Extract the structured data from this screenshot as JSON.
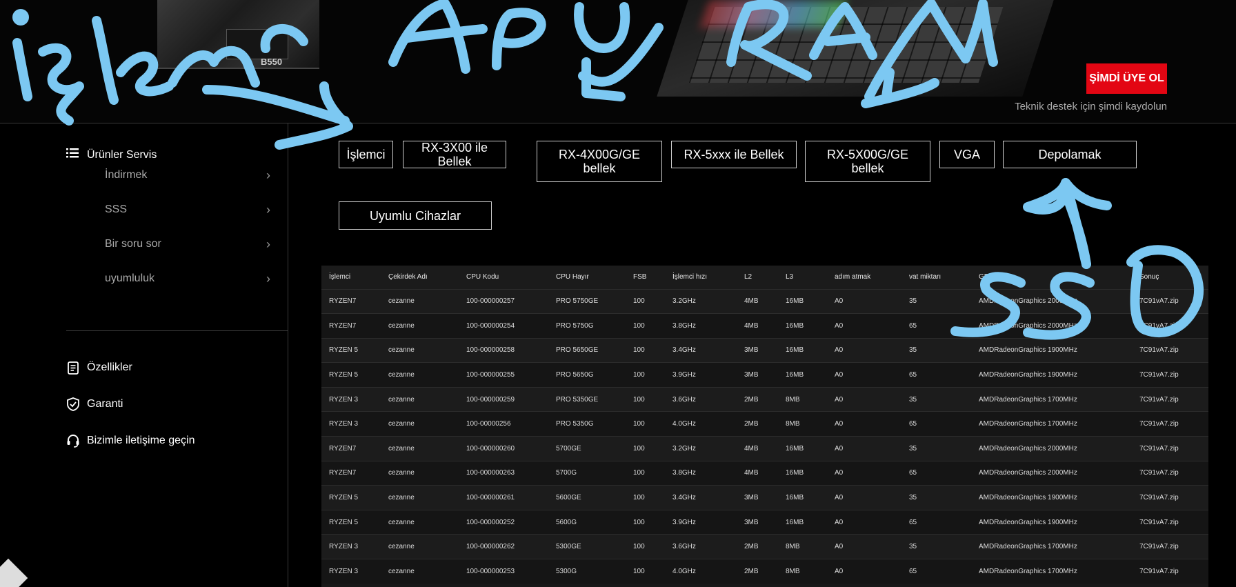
{
  "header": {
    "mobo_text": "B550",
    "signup_button": "ŞİMDİ ÜYE OL",
    "signup_note": "Teknik destek için şimdi kaydolun"
  },
  "sidebar": {
    "heading": "Ürünler Servis",
    "items": [
      {
        "label": "İndirmek"
      },
      {
        "label": "SSS"
      },
      {
        "label": "Bir soru sor"
      },
      {
        "label": "uyumluluk"
      }
    ],
    "links": [
      {
        "label": "Özellikler",
        "icon": "document-icon"
      },
      {
        "label": "Garanti",
        "icon": "shield-check-icon"
      },
      {
        "label": "Bizimle iletişime geçin",
        "icon": "headset-icon"
      }
    ]
  },
  "tabs": [
    {
      "label": "İşlemci"
    },
    {
      "label": "RX-3X00 ile Bellek"
    },
    {
      "label": "RX-4X00G/GE bellek"
    },
    {
      "label": "RX-5xxx ile Bellek"
    },
    {
      "label": "RX-5X00G/GE bellek"
    },
    {
      "label": "VGA"
    },
    {
      "label": "Depolamak"
    },
    {
      "label": "Uyumlu Cihazlar"
    }
  ],
  "table": {
    "headers": [
      "İşlemci",
      "Çekirdek Adı",
      "CPU Kodu",
      "CPU Hayır",
      "FSB",
      "İşlemci hızı",
      "L2",
      "L3",
      "adım atmak",
      "vat miktarı",
      "GPU",
      "Sonuç"
    ],
    "rows": [
      [
        "RYZEN7",
        "cezanne",
        "100-000000257",
        "PRO 5750GE",
        "100",
        "3.2GHz",
        "4MB",
        "16MB",
        "A0",
        "35",
        "AMDRadeonGraphics 2000MHz",
        "7C91vA7.zip"
      ],
      [
        "RYZEN7",
        "cezanne",
        "100-000000254",
        "PRO 5750G",
        "100",
        "3.8GHz",
        "4MB",
        "16MB",
        "A0",
        "65",
        "AMDRadeonGraphics 2000MHz",
        "7C91vA7.zip"
      ],
      [
        "RYZEN 5",
        "cezanne",
        "100-000000258",
        "PRO 5650GE",
        "100",
        "3.4GHz",
        "3MB",
        "16MB",
        "A0",
        "35",
        "AMDRadeonGraphics 1900MHz",
        "7C91vA7.zip"
      ],
      [
        "RYZEN 5",
        "cezanne",
        "100-000000255",
        "PRO 5650G",
        "100",
        "3.9GHz",
        "3MB",
        "16MB",
        "A0",
        "65",
        "AMDRadeonGraphics 1900MHz",
        "7C91vA7.zip"
      ],
      [
        "RYZEN 3",
        "cezanne",
        "100-000000259",
        "PRO 5350GE",
        "100",
        "3.6GHz",
        "2MB",
        "8MB",
        "A0",
        "35",
        "AMDRadeonGraphics 1700MHz",
        "7C91vA7.zip"
      ],
      [
        "RYZEN 3",
        "cezanne",
        "100-00000256",
        "PRO 5350G",
        "100",
        "4.0GHz",
        "2MB",
        "8MB",
        "A0",
        "65",
        "AMDRadeonGraphics 1700MHz",
        "7C91vA7.zip"
      ],
      [
        "RYZEN7",
        "cezanne",
        "100-000000260",
        "5700GE",
        "100",
        "3.2GHz",
        "4MB",
        "16MB",
        "A0",
        "35",
        "AMDRadeonGraphics 2000MHz",
        "7C91vA7.zip"
      ],
      [
        "RYZEN7",
        "cezanne",
        "100-000000263",
        "5700G",
        "100",
        "3.8GHz",
        "4MB",
        "16MB",
        "A0",
        "65",
        "AMDRadeonGraphics 2000MHz",
        "7C91vA7.zip"
      ],
      [
        "RYZEN 5",
        "cezanne",
        "100-000000261",
        "5600GE",
        "100",
        "3.4GHz",
        "3MB",
        "16MB",
        "A0",
        "35",
        "AMDRadeonGraphics 1900MHz",
        "7C91vA7.zip"
      ],
      [
        "RYZEN 5",
        "cezanne",
        "100-000000252",
        "5600G",
        "100",
        "3.9GHz",
        "3MB",
        "16MB",
        "A0",
        "65",
        "AMDRadeonGraphics 1900MHz",
        "7C91vA7.zip"
      ],
      [
        "RYZEN 3",
        "cezanne",
        "100-000000262",
        "5300GE",
        "100",
        "3.6GHz",
        "2MB",
        "8MB",
        "A0",
        "35",
        "AMDRadeonGraphics 1700MHz",
        "7C91vA7.zip"
      ],
      [
        "RYZEN 3",
        "cezanne",
        "100-000000253",
        "5300G",
        "100",
        "4.0GHz",
        "2MB",
        "8MB",
        "A0",
        "65",
        "AMDRadeonGraphics 1700MHz",
        "7C91vA7.zip"
      ]
    ]
  },
  "colors": {
    "signup_red": "#e30613",
    "scribble_blue": "#7cc8f2"
  }
}
